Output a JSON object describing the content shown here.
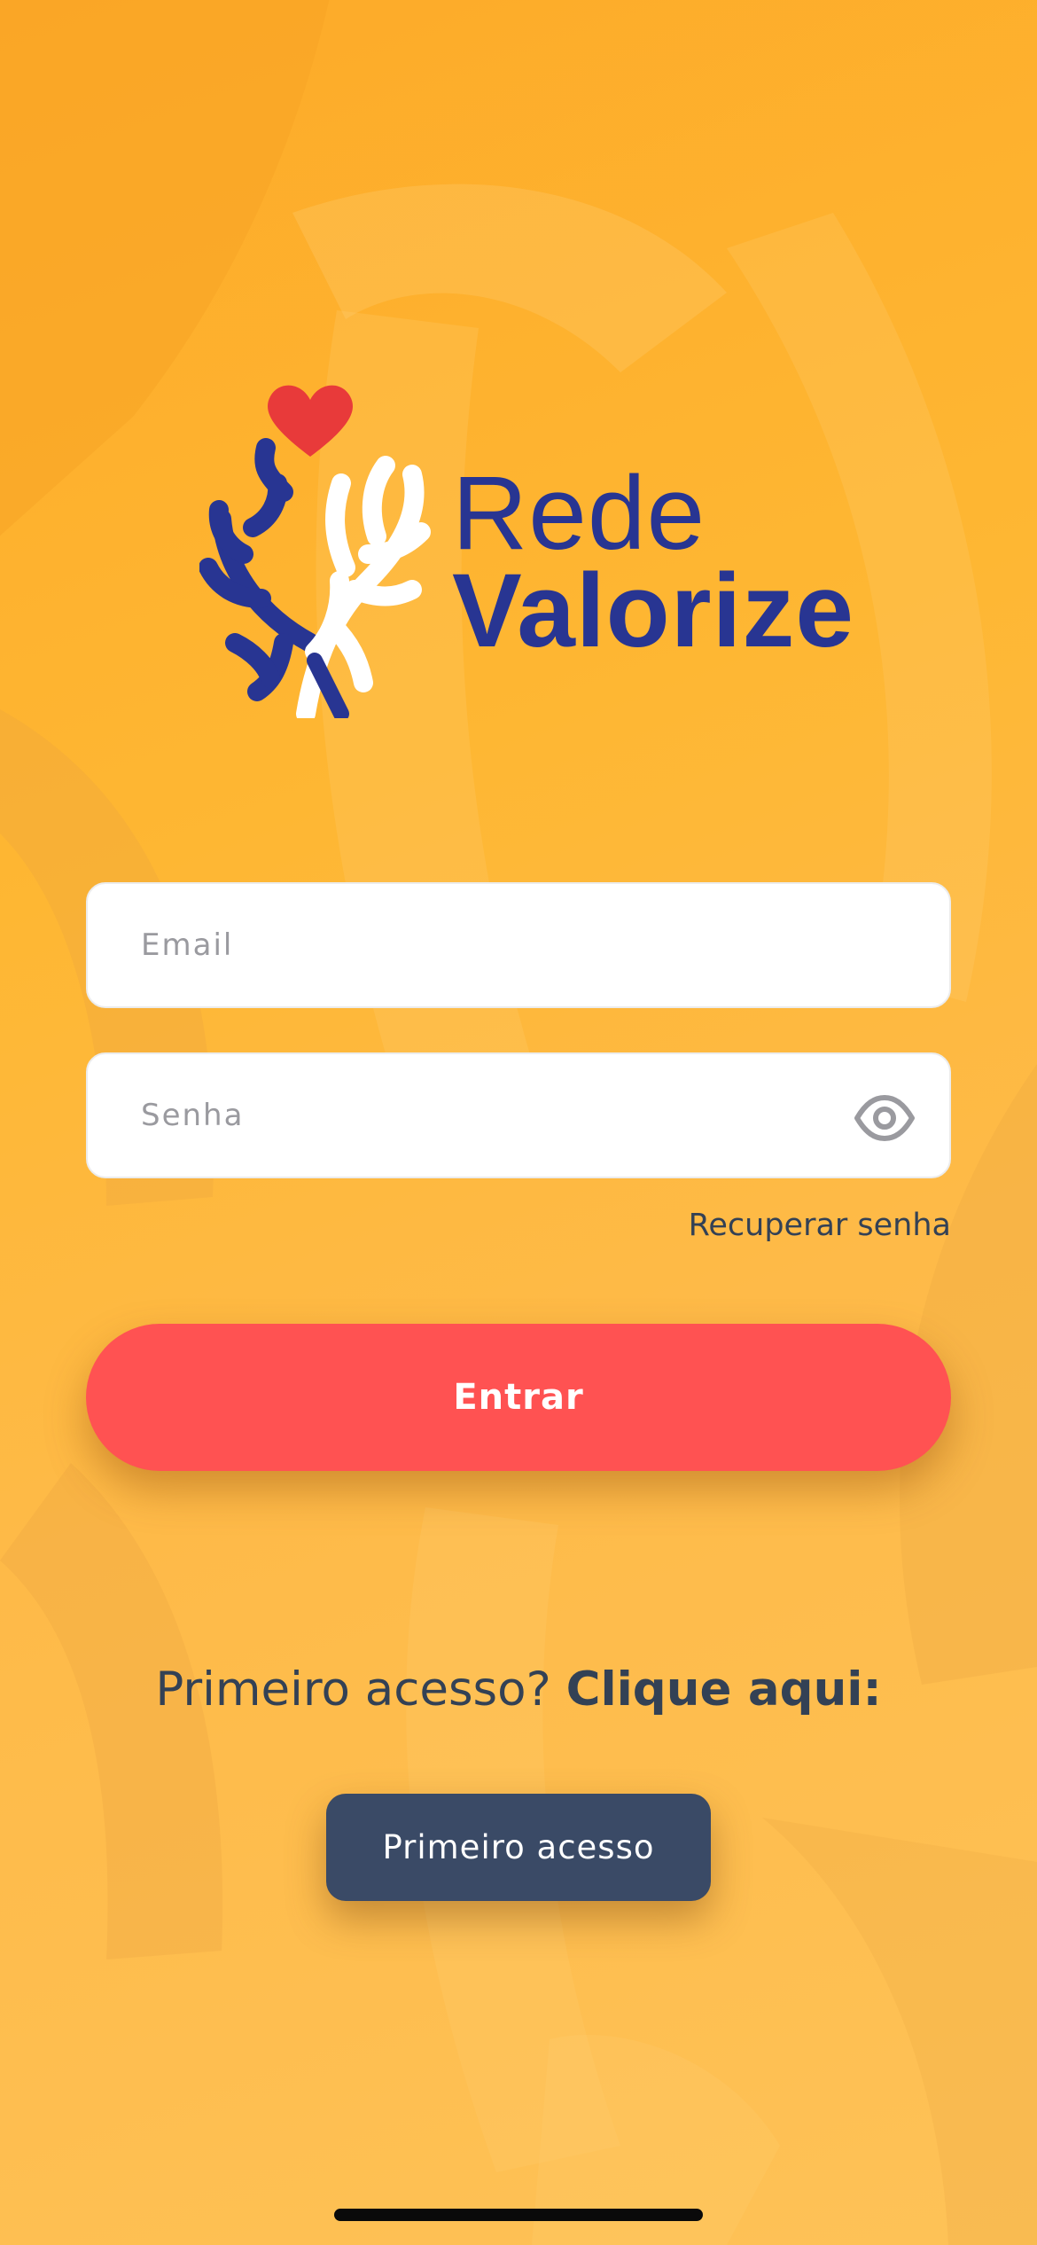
{
  "brand": {
    "line1": "Rede",
    "line2": "Valorize",
    "colors": {
      "primary": "#283592",
      "heart": "#e83a3a",
      "background": "#feb733"
    }
  },
  "form": {
    "email": {
      "placeholder": "Email",
      "value": ""
    },
    "password": {
      "placeholder": "Senha",
      "value": "",
      "toggle_icon": "eye-icon"
    },
    "recover_label": "Recuperar senha",
    "submit_label": "Entrar",
    "submit_color": "#ff5252"
  },
  "first_access": {
    "prompt": "Primeiro acesso?",
    "prompt_bold": "Clique aqui:",
    "button_label": "Primeiro acesso",
    "button_color": "#3a4a66"
  }
}
